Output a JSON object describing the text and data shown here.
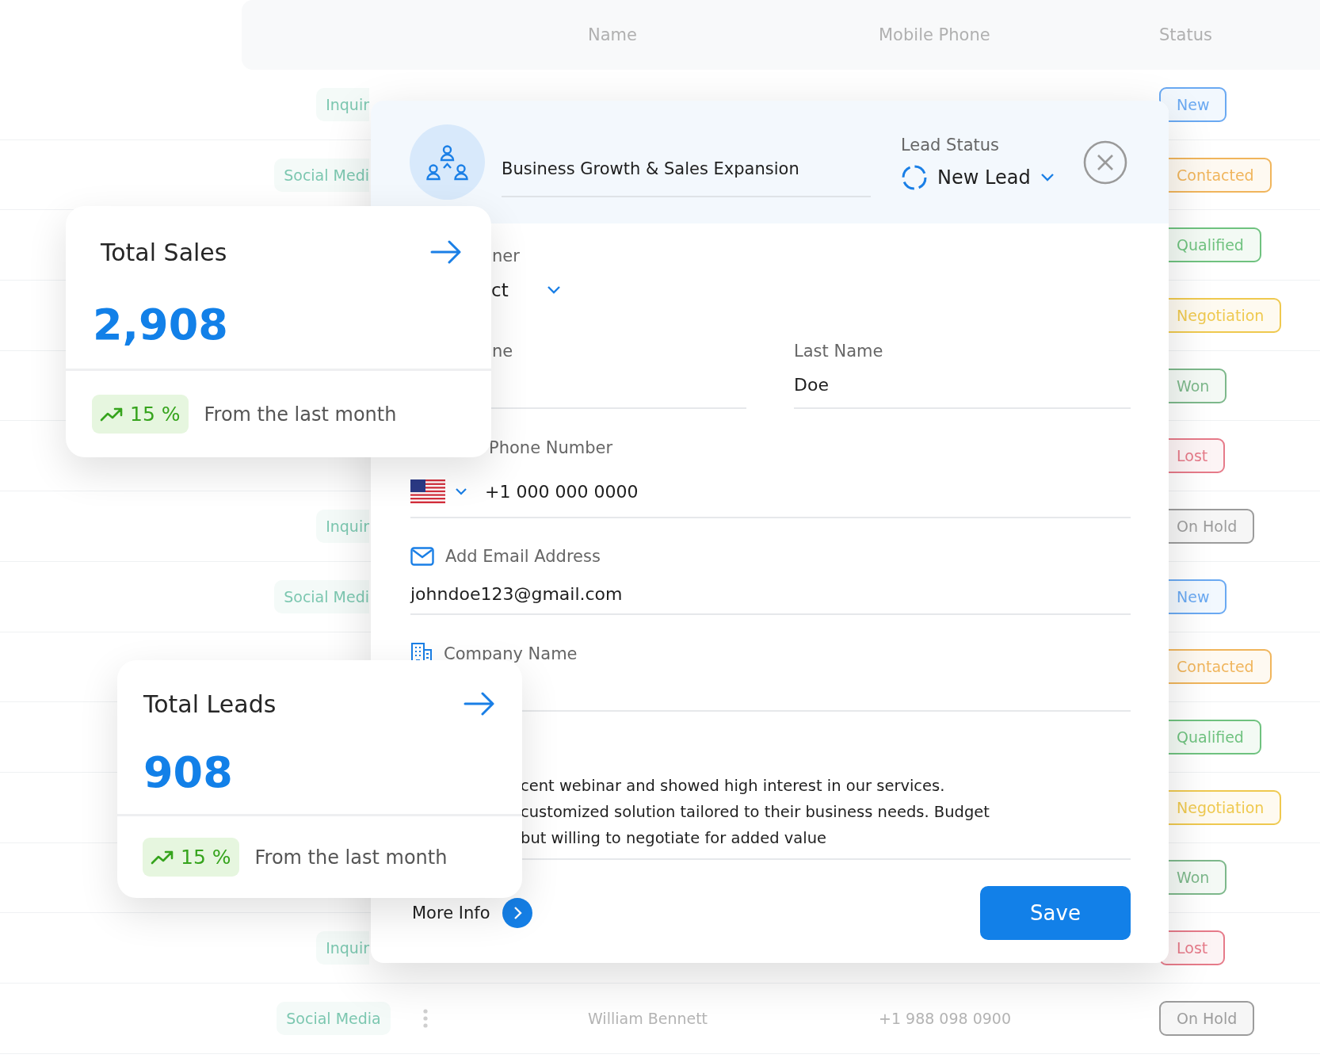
{
  "table": {
    "columns": [
      "Name",
      "Mobile Phone",
      "Status"
    ],
    "rows": [
      {
        "source": "Inquir",
        "status": "New",
        "color": "#6aa9f2"
      },
      {
        "source": "Social Medi",
        "status": "Contacted",
        "color": "#f0b55c"
      },
      {
        "status": "Qualified",
        "color": "#6fc27f"
      },
      {
        "status": "Negotiation",
        "color": "#efc94f"
      },
      {
        "status": "Won",
        "color": "#7db88b"
      },
      {
        "status": "Lost",
        "color": "#e67a89"
      },
      {
        "source": "Inquir",
        "status": "On Hold",
        "color": "#9c9c9c"
      },
      {
        "source": "Social Medi",
        "status": "New",
        "color": "#6aa9f2"
      },
      {
        "status": "Contacted",
        "color": "#f0b55c"
      },
      {
        "status": "Qualified",
        "color": "#6fc27f"
      },
      {
        "status": "Negotiation",
        "color": "#efc94f"
      },
      {
        "status": "Won",
        "color": "#7db88b"
      },
      {
        "source": "Inquir",
        "status": "Lost",
        "color": "#e67a89"
      },
      {
        "source": "Social Media",
        "name": "William Bennett",
        "phone": "+1 988 098 0900",
        "status": "On Hold",
        "color": "#9c9c9c"
      }
    ]
  },
  "lead_form": {
    "title": "Business Growth & Sales Expansion",
    "lead_status_label": "Lead Status",
    "lead_status": "New Lead",
    "owner_label": "ner",
    "owner_value": "ct",
    "first_name_label": "ne",
    "last_name_label": "Last Name",
    "last_name": "Doe",
    "phone_label": "Phone Number",
    "phone": "+1 000 000 0000",
    "email_label": "Add Email Address",
    "email": "johndoe123@gmail.com",
    "company_label": "Company Name",
    "description_lines": [
      "cent webinar and showed high interest in our services.",
      "customized solution tailored to their business needs. Budget",
      "but willing to negotiate for added value"
    ],
    "more_info": "More Info",
    "save": "Save"
  },
  "stat_cards": [
    {
      "title": "Total Sales",
      "value": "2,908",
      "change": "15 %",
      "note": "From the last month"
    },
    {
      "title": "Total Leads",
      "value": "908",
      "change": "15 %",
      "note": "From the last month"
    }
  ]
}
